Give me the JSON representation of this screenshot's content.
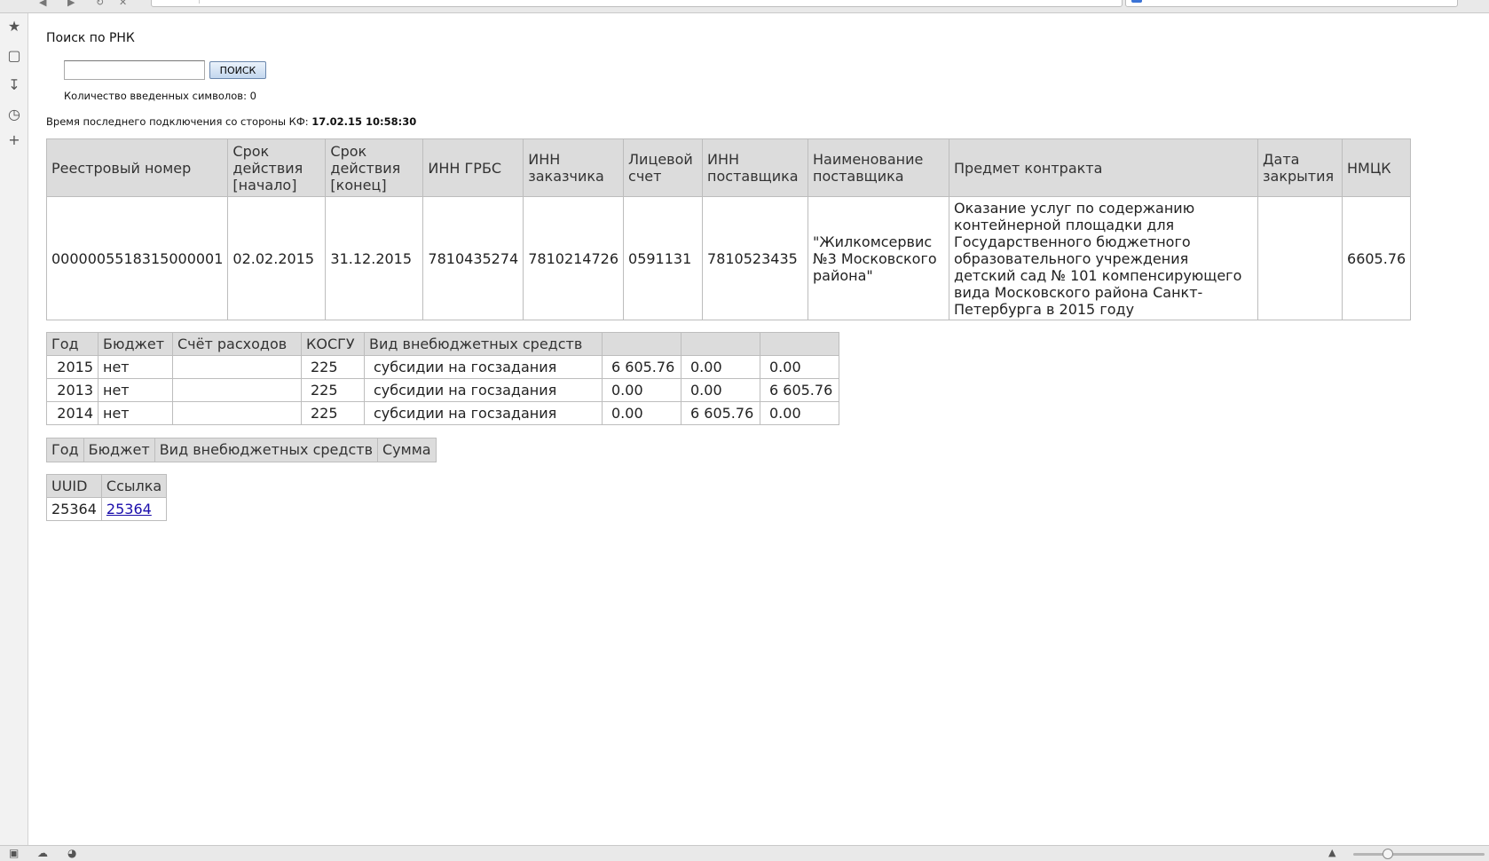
{
  "page": {
    "title": "Поиск по РНК",
    "search_button": "ПОИСК",
    "search_value": "",
    "char_count_label": "Количество введенных символов: 0",
    "last_conn_label": "Время последнего подключения со стороны КФ:",
    "last_conn_value": "17.02.15 10:58:30"
  },
  "contract": {
    "headers": [
      "Реестровый номер",
      "Срок действия [начало]",
      "Срок действия [конец]",
      "ИНН ГРБС",
      "ИНН заказчика",
      "Лицевой счет",
      "ИНН поставщика",
      "Наименование поставщика",
      "Предмет контракта",
      "Дата закрытия",
      "НМЦК"
    ],
    "row": [
      "0000005518315000001",
      "02.02.2015",
      "31.12.2015",
      "7810435274",
      "7810214726",
      "0591131",
      "7810523435",
      "\"Жилкомсервис №3 Московского района\"",
      "Оказание услуг по содержанию контейнерной площадки для Государственного бюджетного образовательного учреждения детский сад № 101 компенсирующего вида Московского района Санкт-Петербурга в 2015 году",
      "",
      "6605.76"
    ]
  },
  "finance": {
    "headers": [
      "Год",
      "Бюджет",
      "Счёт расходов",
      "КОСГУ",
      "Вид внебюджетных средств",
      "",
      "",
      ""
    ],
    "rows": [
      [
        "2015",
        "нет",
        "",
        "225",
        "субсидии на госзадания",
        "6 605.76",
        "0.00",
        "0.00"
      ],
      [
        "2013",
        "нет",
        "",
        "225",
        "субсидии на госзадания",
        "0.00",
        "0.00",
        "6 605.76"
      ],
      [
        "2014",
        "нет",
        "",
        "225",
        "субсидии на госзадания",
        "0.00",
        "6 605.76",
        "0.00"
      ]
    ]
  },
  "offbudget": {
    "headers": [
      "Год",
      "Бюджет",
      "Вид внебюджетных средств",
      "Сумма"
    ]
  },
  "uuid": {
    "headers": [
      "UUID",
      "Ссылка"
    ],
    "row": [
      "25364",
      "25364"
    ]
  }
}
